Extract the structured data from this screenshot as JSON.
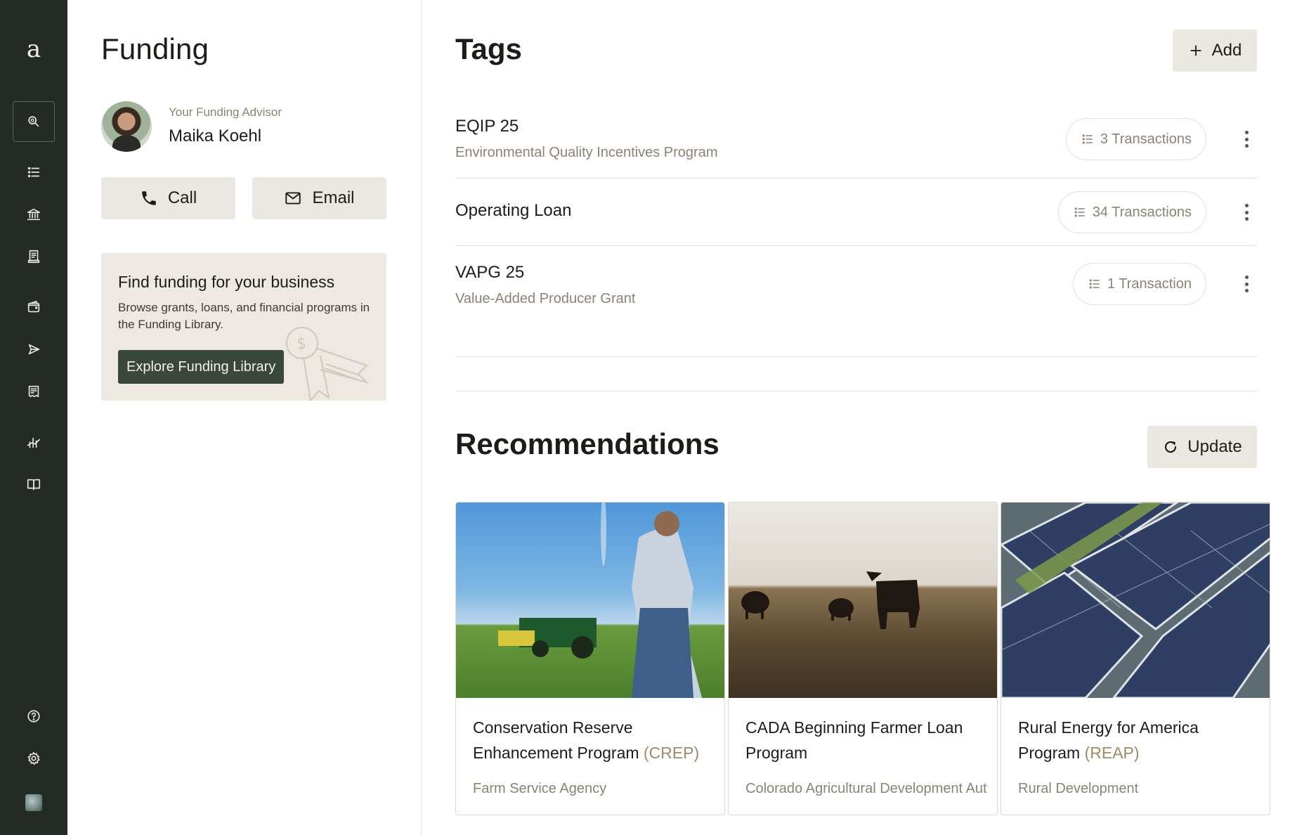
{
  "sidebar": {
    "logo": "a",
    "items": [
      {
        "name": "search",
        "icon": "search-icon"
      },
      {
        "name": "list",
        "icon": "list-icon"
      },
      {
        "name": "bank",
        "icon": "bank-icon"
      },
      {
        "name": "receipt",
        "icon": "receipt-icon"
      },
      {
        "name": "wallet",
        "icon": "wallet-icon"
      },
      {
        "name": "send",
        "icon": "send-icon"
      },
      {
        "name": "invoice",
        "icon": "invoice-icon"
      },
      {
        "name": "reports",
        "icon": "chart-icon"
      },
      {
        "name": "library",
        "icon": "book-icon"
      },
      {
        "name": "help",
        "icon": "help-icon"
      },
      {
        "name": "settings",
        "icon": "gear-icon"
      },
      {
        "name": "account",
        "icon": "avatar-icon"
      }
    ]
  },
  "funding": {
    "title": "Funding",
    "advisor_label": "Your Funding Advisor",
    "advisor_name": "Maika Koehl",
    "call_label": "Call",
    "email_label": "Email",
    "promo": {
      "title": "Find funding for your business",
      "text": "Browse grants, loans, and financial programs in the Funding Library.",
      "button": "Explore Funding Library"
    }
  },
  "tags": {
    "title": "Tags",
    "add_label": "Add",
    "rows": [
      {
        "name": "EQIP 25",
        "description": "Environmental Quality Incentives Program",
        "transactions": "3 Transactions"
      },
      {
        "name": "Operating Loan",
        "description": "",
        "transactions": "34 Transactions"
      },
      {
        "name": "VAPG 25",
        "description": "Value-Added Producer Grant",
        "transactions": "1 Transaction"
      }
    ]
  },
  "recommendations": {
    "title": "Recommendations",
    "update_label": "Update",
    "cards": [
      {
        "title": "Conservation Reserve Enhancement Program",
        "abbr": "(CREP)",
        "agency": "Farm Service Agency",
        "image": "farmer-field-photo"
      },
      {
        "title": "CADA Beginning Farmer Loan Program",
        "abbr": "",
        "agency": "Colorado Agricultural Development Aut",
        "image": "cattle-field-photo"
      },
      {
        "title": "Rural Energy for America Program",
        "abbr": "(REAP)",
        "agency": "Rural Development",
        "image": "solar-panels-photo"
      }
    ]
  },
  "colors": {
    "sidebar_bg": "#242b25",
    "button_bg": "#ebe8e2",
    "promo_button_bg": "#39473c",
    "muted_text": "#8c8375"
  }
}
